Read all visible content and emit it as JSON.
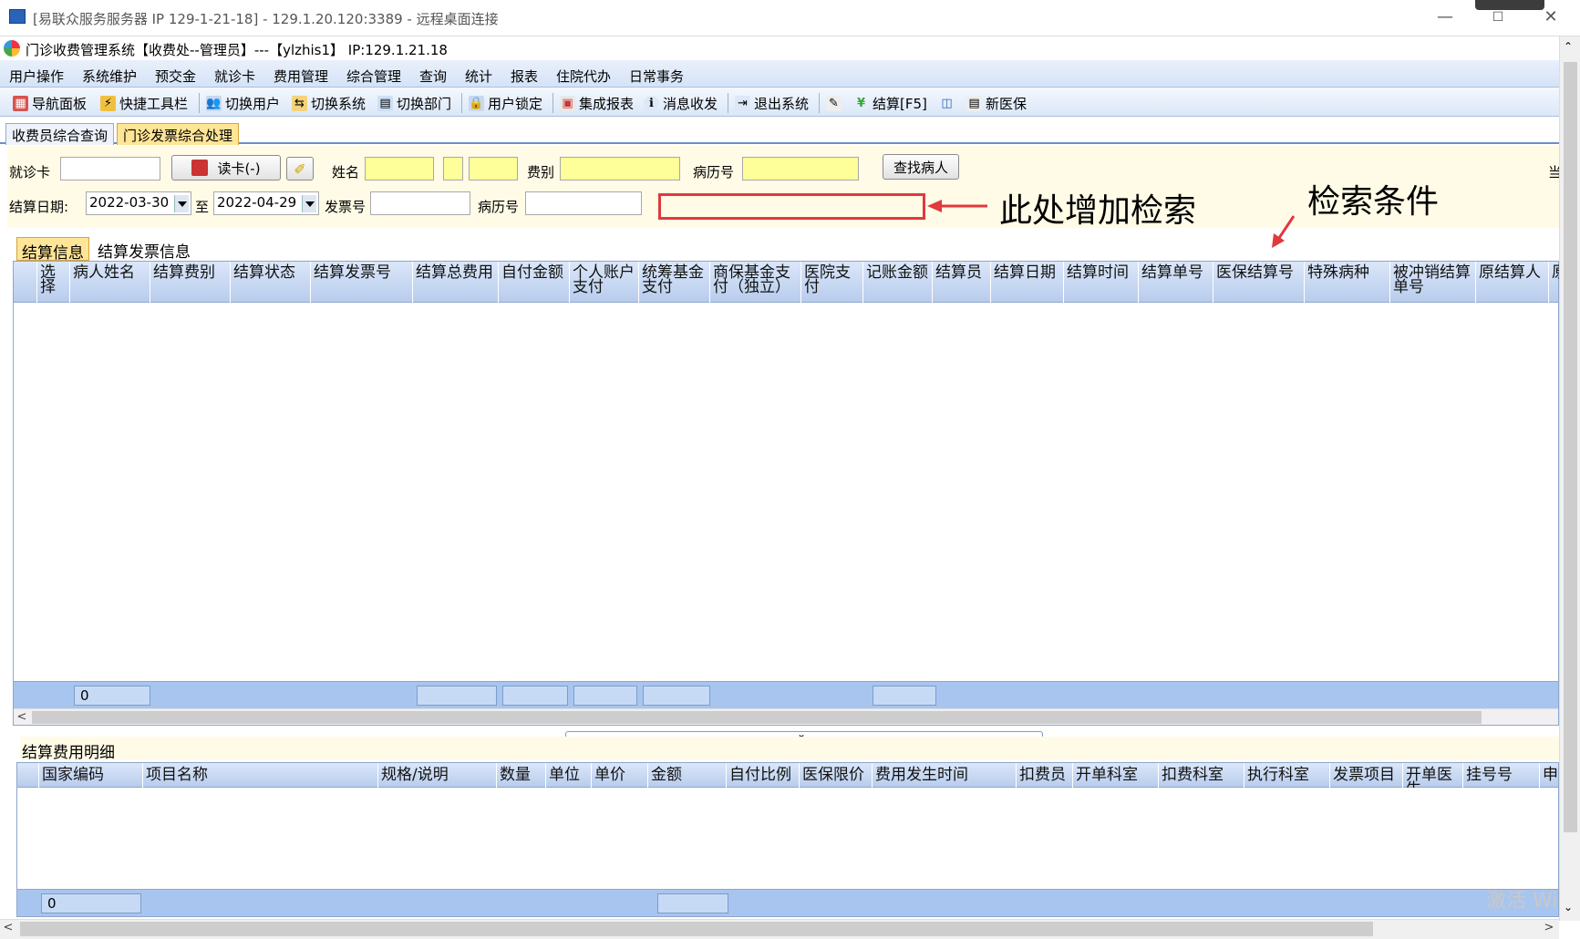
{
  "rdp_window": {
    "title": "[易联众服务服务器 IP 129-1-21-18] - 129.1.20.120:3389 - 远程桌面连接",
    "minimize": "—",
    "maximize": "☐",
    "close": "✕"
  },
  "app": {
    "title": "门诊收费管理系统【收费处--管理员】---【ylzhis1】 IP:129.1.21.18"
  },
  "menu": [
    "用户操作",
    "系统维护",
    "预交金",
    "就诊卡",
    "费用管理",
    "综合管理",
    "查询",
    "统计",
    "报表",
    "住院代办",
    "日常事务"
  ],
  "toolbar": {
    "items": [
      {
        "label": "导航面板",
        "icon": "navigation-panel-icon"
      },
      {
        "label": "快捷工具栏",
        "icon": "shortcut-toolbar-icon"
      },
      {
        "label": "切换用户",
        "icon": "switch-user-icon"
      },
      {
        "label": "切换系统",
        "icon": "switch-system-icon"
      },
      {
        "label": "切换部门",
        "icon": "switch-department-icon"
      },
      {
        "label": "用户锁定",
        "icon": "user-lock-icon"
      },
      {
        "label": "集成报表",
        "icon": "report-icon"
      },
      {
        "label": "消息收发",
        "icon": "message-icon"
      },
      {
        "label": "退出系统",
        "icon": "exit-icon"
      },
      {
        "label": "结算[F5]",
        "icon": "settle-icon"
      },
      {
        "label": "新医保",
        "icon": "insurance-icon"
      }
    ]
  },
  "tabs": [
    "收费员综合查询",
    "门诊发票综合处理"
  ],
  "filter": {
    "card_label": "就诊卡",
    "read_card_button": "读卡(-)",
    "name_label": "姓名",
    "fee_type_label": "费别",
    "record_no_label": "病历号",
    "find_patient_button": "查找病人",
    "settle_date_label": "结算日期:",
    "date_from": "2022-03-30",
    "to_label": "至",
    "date_to": "2022-04-29",
    "invoice_no_label": "发票号",
    "record_no_label2": "病历号",
    "edge_char": "当"
  },
  "annotations": {
    "add_search": "此处增加检索",
    "search_condition": "检索条件",
    "arrow_color": "#e0393e"
  },
  "subtabs": [
    "结算信息",
    "结算发票信息"
  ],
  "settlement_columns": [
    "选择",
    "病人姓名",
    "结算费别",
    "结算状态",
    "结算发票号",
    "结算总费用",
    "自付金额",
    "个人账户支付",
    "统筹基金支付",
    "商保基金支付（独立）",
    "医院支付",
    "记账金额",
    "结算员",
    "结算日期",
    "结算时间",
    "结算单号",
    "医保结算号",
    "特殊病种",
    "被冲销结算单号",
    "原结算人",
    "原"
  ],
  "settlement_summary": {
    "count": "0"
  },
  "detail": {
    "label": "结算费用明细",
    "columns": [
      "国家编码",
      "项目名称",
      "规格/说明",
      "数量",
      "单位",
      "单价",
      "金额",
      "自付比例",
      "医保限价",
      "费用发生时间",
      "扣费员",
      "开单科室",
      "扣费科室",
      "执行科室",
      "发票项目",
      "开单医生",
      "挂号号",
      "申"
    ],
    "summary_count": "0"
  },
  "watermark": "激活 Wi"
}
